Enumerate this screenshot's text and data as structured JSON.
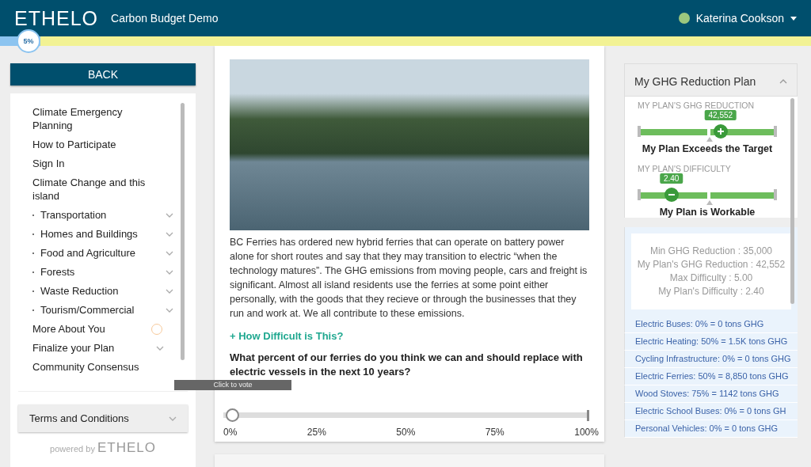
{
  "header": {
    "logo": "ETHELO",
    "title": "Carbon Budget Demo",
    "user": "Katerina Cookson",
    "progress": "5%",
    "level": 0.05
  },
  "sidebar": {
    "back": "BACK",
    "items": [
      {
        "label": "Climate Emergency Planning",
        "kind": "page"
      },
      {
        "label": "How to Participate",
        "kind": "page"
      },
      {
        "label": "Sign In",
        "kind": "page"
      },
      {
        "label": "Climate Change and this island",
        "kind": "page"
      },
      {
        "label": "Transportation",
        "kind": "topic"
      },
      {
        "label": "Homes and Buildings",
        "kind": "topic"
      },
      {
        "label": "Food and Agriculture",
        "kind": "topic"
      },
      {
        "label": "Forests",
        "kind": "topic"
      },
      {
        "label": "Waste Reduction",
        "kind": "topic"
      },
      {
        "label": "Tourism/Commercial",
        "kind": "topic"
      },
      {
        "label": "More About You",
        "kind": "pending"
      },
      {
        "label": "Finalize your Plan",
        "kind": "group"
      },
      {
        "label": "Community Consensus",
        "kind": "page"
      }
    ],
    "terms": "Terms and Conditions",
    "powered_by": "powered by",
    "powered_logo": "ETHELO"
  },
  "question": {
    "description": "BC Ferries has ordered new hybrid ferries that can operate on battery power alone for short routes and say that they may transition to electric “when the technology matures”. The GHG emissions from moving people, cars and freight is significant. Almost all island residents use the ferries at some point either personally, with the goods that they recieve or through the businesses that they run and work at. We all contribute to these emissions.",
    "difficulty_link": "+ How Difficult is This?",
    "prompt": "What percent of our ferries do you think we can and should replace with electric vessels in the next 10 years?",
    "tooltip": "Click to vote",
    "slider": {
      "level": 0,
      "ticks": [
        "0%",
        "25%",
        "50%",
        "75%",
        "100%"
      ]
    }
  },
  "plan": {
    "title": "My GHG Reduction Plan",
    "meters": [
      {
        "label": "MY PLAN'S GHG REDUCTION",
        "value": "42,552",
        "level": 0.6,
        "status": "My Plan Exceeds the Target"
      },
      {
        "label": "MY PLAN'S DIFFICULTY",
        "value": "2.40",
        "level": 0.23,
        "status": "My Plan is Workable"
      }
    ],
    "stats": [
      "Min GHG Reduction : 35,000",
      "My Plan's GHG Reduction : 42,552",
      "Max Difficulty : 5.00",
      "My Plan's Difficulty : 2.40"
    ],
    "items": [
      "Electric Buses: 0% = 0 tons GHG",
      "Electric Heating: 50% = 1.5K tons GHG",
      "Cycling Infrastructure: 0% = 0 tons GHG",
      "Electric Ferries: 50% = 8,850 tons GHG",
      "Wood Stoves: 75% = 1142 tons GHG",
      "Electric School Buses: 0% = 0 tons GH",
      "Personal Vehicles: 0% = 0 tons GHG"
    ]
  }
}
